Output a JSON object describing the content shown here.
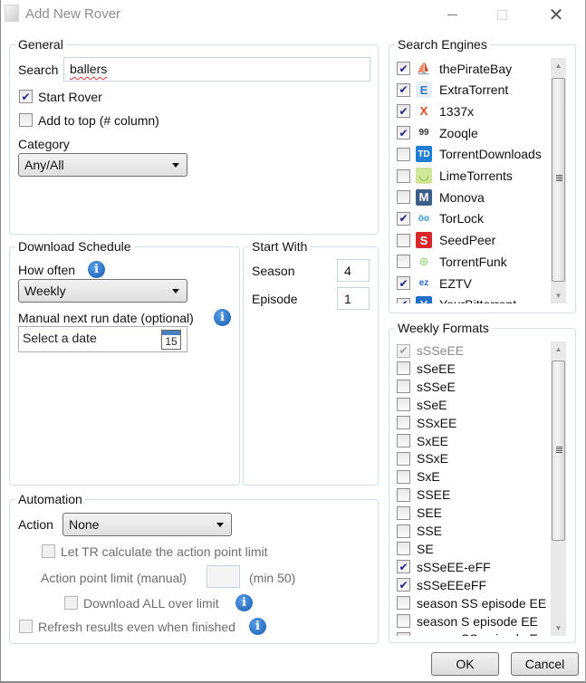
{
  "window": {
    "title": "Add New Rover",
    "controls": {
      "minimize": "minimize",
      "maximize": "maximize",
      "close": "✕"
    }
  },
  "general": {
    "legend": "General",
    "search_label": "Search",
    "search_value": "ballers",
    "start_rover": {
      "label": "Start Rover",
      "checked": true
    },
    "add_to_top": {
      "label": "Add to top (# column)",
      "checked": false
    },
    "category_label": "Category",
    "category_value": "Any/All"
  },
  "download_schedule": {
    "legend": "Download Schedule",
    "how_often_label": "How often",
    "how_often_value": "Weekly",
    "manual_date_label": "Manual next run date (optional)",
    "date_placeholder": "Select a date",
    "calendar_day": "15"
  },
  "start_with": {
    "legend": "Start With",
    "season_label": "Season",
    "season_value": "4",
    "episode_label": "Episode",
    "episode_value": "1"
  },
  "automation": {
    "legend": "Automation",
    "action_label": "Action",
    "action_value": "None",
    "let_tr_calc": {
      "label": "Let TR calculate the action point limit",
      "checked": false
    },
    "action_point_label": "Action point limit (manual)",
    "action_point_value": "",
    "action_point_min": "(min 50)",
    "download_all": {
      "label": "Download ALL over limit",
      "checked": false
    },
    "refresh_results": {
      "label": "Refresh results even when finished",
      "checked": false
    }
  },
  "search_engines": {
    "legend": "Search Engines",
    "items": [
      {
        "name": "thePirateBay",
        "checked": true,
        "icon": "ship-icon",
        "glyph": "⛵",
        "color": "#8a5a2b",
        "bg": "transparent"
      },
      {
        "name": "ExtraTorrent",
        "checked": true,
        "icon": "extratorrent-icon",
        "glyph": "E",
        "color": "#3a7bbf",
        "bg": "#e6eef6"
      },
      {
        "name": "1337x",
        "checked": true,
        "icon": "1337x-icon",
        "glyph": "X",
        "color": "#e8481c",
        "bg": "transparent"
      },
      {
        "name": "Zooqle",
        "checked": true,
        "icon": "zooqle-icon",
        "glyph": "99",
        "color": "#333333",
        "bg": "transparent"
      },
      {
        "name": "TorrentDownloads",
        "checked": false,
        "icon": "torrentdownloads-icon",
        "glyph": "TD",
        "color": "#ffffff",
        "bg": "#1f7fd4"
      },
      {
        "name": "LimeTorrents",
        "checked": false,
        "icon": "limetorrents-icon",
        "glyph": "◡",
        "color": "#7fae2e",
        "bg": "#cfe59a"
      },
      {
        "name": "Monova",
        "checked": false,
        "icon": "monova-icon",
        "glyph": "M",
        "color": "#ffffff",
        "bg": "#3b5f8a"
      },
      {
        "name": "TorLock",
        "checked": true,
        "icon": "torlock-icon",
        "glyph": "öo",
        "color": "#2f9ad8",
        "bg": "transparent"
      },
      {
        "name": "SeedPeer",
        "checked": false,
        "icon": "seedpeer-icon",
        "glyph": "S",
        "color": "#ffffff",
        "bg": "#d8262a"
      },
      {
        "name": "TorrentFunk",
        "checked": false,
        "icon": "torrentfunk-icon",
        "glyph": "⊕",
        "color": "#a8d88a",
        "bg": "transparent"
      },
      {
        "name": "EZTV",
        "checked": true,
        "icon": "eztv-icon",
        "glyph": "ez",
        "color": "#2a6ad0",
        "bg": "transparent"
      },
      {
        "name": "YourBittorrent",
        "checked": true,
        "icon": "yourbittorrent-icon",
        "glyph": "Y",
        "color": "#ffffff",
        "bg": "#1d6fc8"
      }
    ]
  },
  "weekly_formats": {
    "legend": "Weekly Formats",
    "items": [
      {
        "label": "sSSeEE",
        "checked": true,
        "disabled": true
      },
      {
        "label": "sSeEE",
        "checked": false
      },
      {
        "label": "sSSeE",
        "checked": false
      },
      {
        "label": "sSeE",
        "checked": false
      },
      {
        "label": "SSxEE",
        "checked": false
      },
      {
        "label": "SxEE",
        "checked": false
      },
      {
        "label": "SSxE",
        "checked": false
      },
      {
        "label": "SxE",
        "checked": false
      },
      {
        "label": "SSEE",
        "checked": false
      },
      {
        "label": "SEE",
        "checked": false
      },
      {
        "label": "SSE",
        "checked": false
      },
      {
        "label": "SE",
        "checked": false
      },
      {
        "label": "sSSeEE-eFF",
        "checked": true
      },
      {
        "label": "sSSeEEeFF",
        "checked": true
      },
      {
        "label": "season SS episode EE",
        "checked": false
      },
      {
        "label": "season S episode EE",
        "checked": false
      },
      {
        "label": "season SS episode E",
        "checked": false
      }
    ]
  },
  "buttons": {
    "ok": "OK",
    "cancel": "Cancel"
  }
}
